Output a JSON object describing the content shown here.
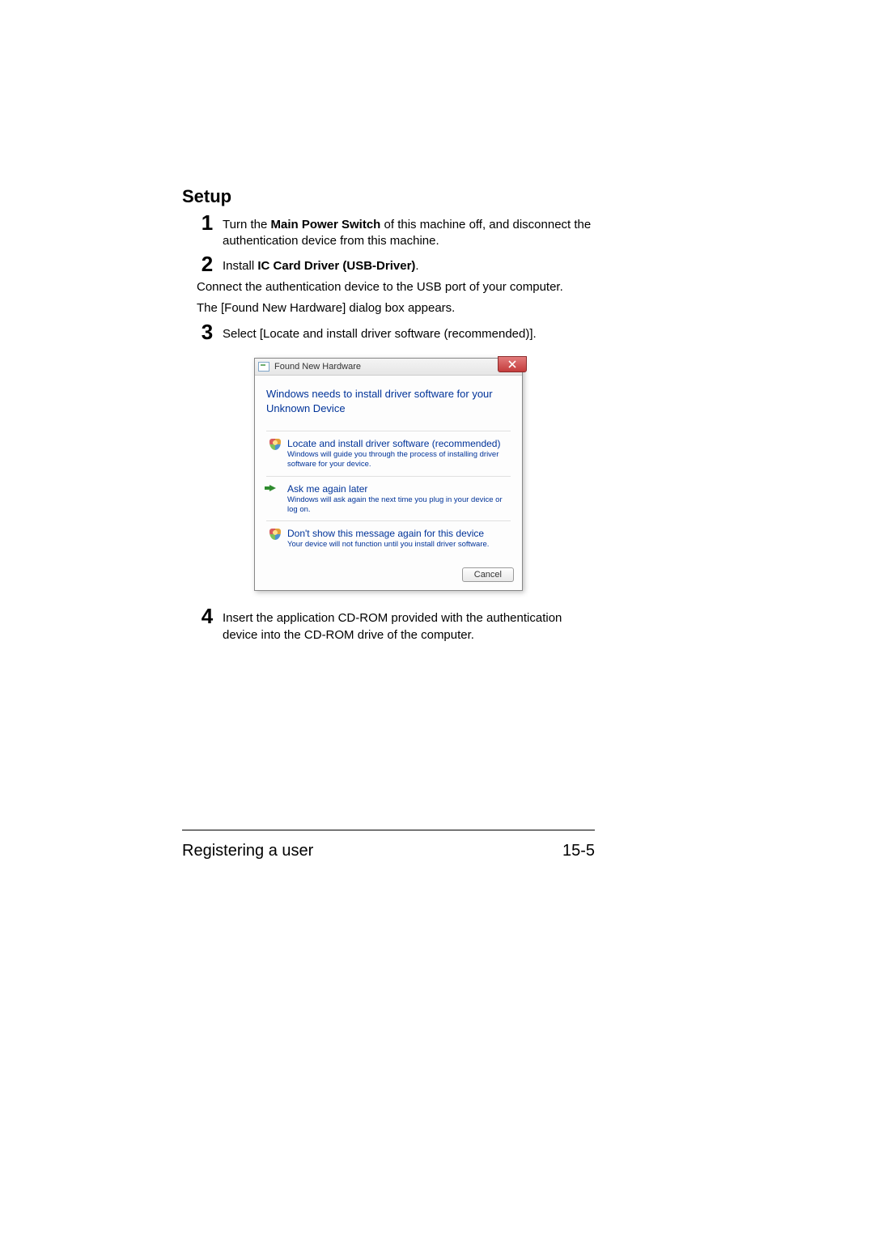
{
  "heading": "Setup",
  "steps": {
    "s1": {
      "num": "1",
      "pre": "Turn the ",
      "bold": "Main Power Switch",
      "post": " of this machine off, and disconnect the authentication device from this machine."
    },
    "s2": {
      "num": "2",
      "pre": "Install ",
      "bold": "IC Card Driver (USB-Driver)",
      "post": "."
    },
    "s3": {
      "num": "3",
      "text": "Select [Locate and install driver software (recommended)]."
    },
    "s4": {
      "num": "4",
      "text": "Insert the application CD-ROM provided with the authentication device into the CD-ROM drive of the computer."
    }
  },
  "plain": {
    "connect": "Connect the authentication device to the USB port of your computer.",
    "dialog_appears": "The [Found New Hardware] dialog box appears."
  },
  "dialog": {
    "title": "Found New Hardware",
    "heading": "Windows needs to install driver software for your Unknown Device",
    "opt1": {
      "title": "Locate and install driver software (recommended)",
      "sub": "Windows will guide you through the process of installing driver software for your device."
    },
    "opt2": {
      "title": "Ask me again later",
      "sub": "Windows will ask again the next time you plug in your device or log on."
    },
    "opt3": {
      "title": "Don't show this message again for this device",
      "sub": "Your device will not function until you install driver software."
    },
    "cancel": "Cancel"
  },
  "footer": {
    "left": "Registering a user",
    "right": "15-5"
  }
}
